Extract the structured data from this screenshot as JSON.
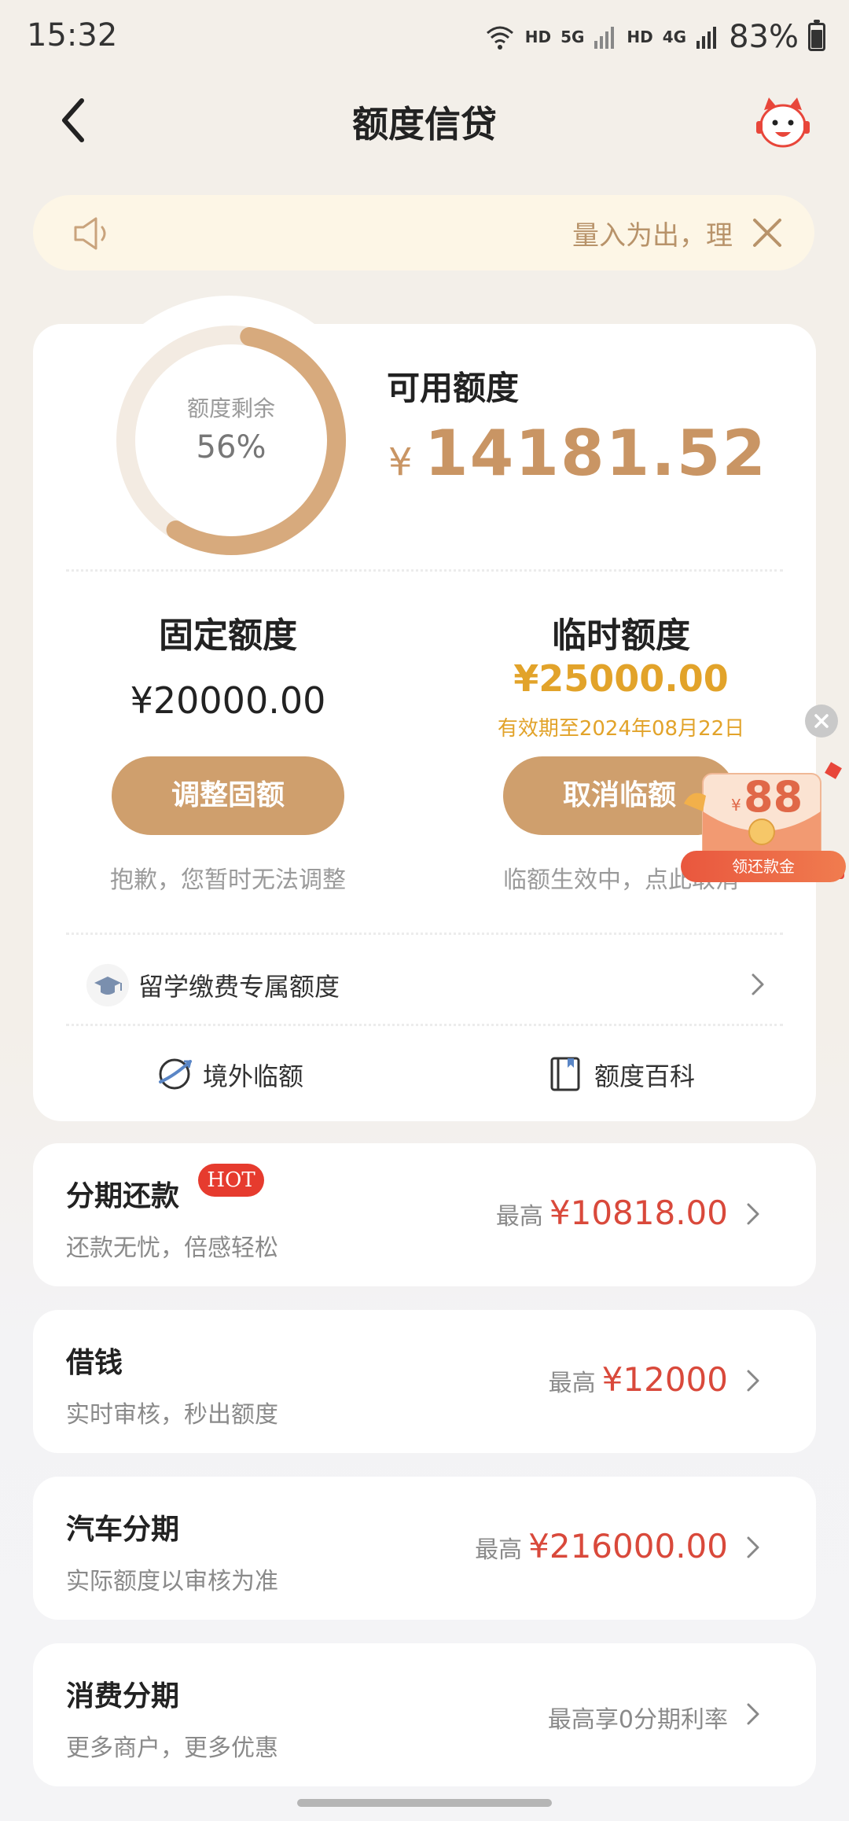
{
  "status_bar": {
    "time": "15:32",
    "wifi_badge": "6",
    "hd1": "HD",
    "net1": "5G",
    "hd2": "HD",
    "net2": "4G",
    "battery": "83%"
  },
  "header": {
    "title": "额度信贷",
    "back_icon": "chevron-left-icon",
    "mascot_icon": "mascot-icon"
  },
  "notice": {
    "text": "量入为出，理"
  },
  "credit": {
    "ring_label": "额度剩余",
    "ring_percent": "56%",
    "ring_fraction": 0.56,
    "available_label": "可用额度",
    "currency": "¥",
    "available_amount": "14181.52",
    "fixed": {
      "title": "固定额度",
      "amount": "¥20000.00",
      "button": "调整固额",
      "note": "抱歉，您暂时无法调整"
    },
    "temporary": {
      "title": "临时额度",
      "amount": "¥25000.00",
      "valid_until": "有效期至2024年08月22日",
      "button": "取消临额",
      "note": "临额生效中，点此取消"
    },
    "study_row": "留学缴费专属额度",
    "quick": {
      "overseas": "境外临额",
      "encyclopedia": "额度百科"
    }
  },
  "products": [
    {
      "title": "分期还款",
      "badge": "HOT",
      "subtitle": "还款无忧，倍感轻松",
      "prefix": "最高",
      "value": "¥10818.00"
    },
    {
      "title": "借钱",
      "subtitle": "实时审核，秒出额度",
      "prefix": "最高",
      "value": "¥12000"
    },
    {
      "title": "汽车分期",
      "subtitle": "实际额度以审核为准",
      "prefix": "最高",
      "value": "¥216000.00"
    },
    {
      "title": "消费分期",
      "subtitle": "更多商户，更多优惠",
      "right_text": "最高享0分期利率"
    }
  ],
  "ad": {
    "yen": "¥",
    "amount": "88",
    "label": "领还款金"
  },
  "colors": {
    "accent": "#cf9f6d",
    "amount_gold": "#c99564",
    "temp_amount": "#e2a32a",
    "price_red": "#d9493b"
  }
}
